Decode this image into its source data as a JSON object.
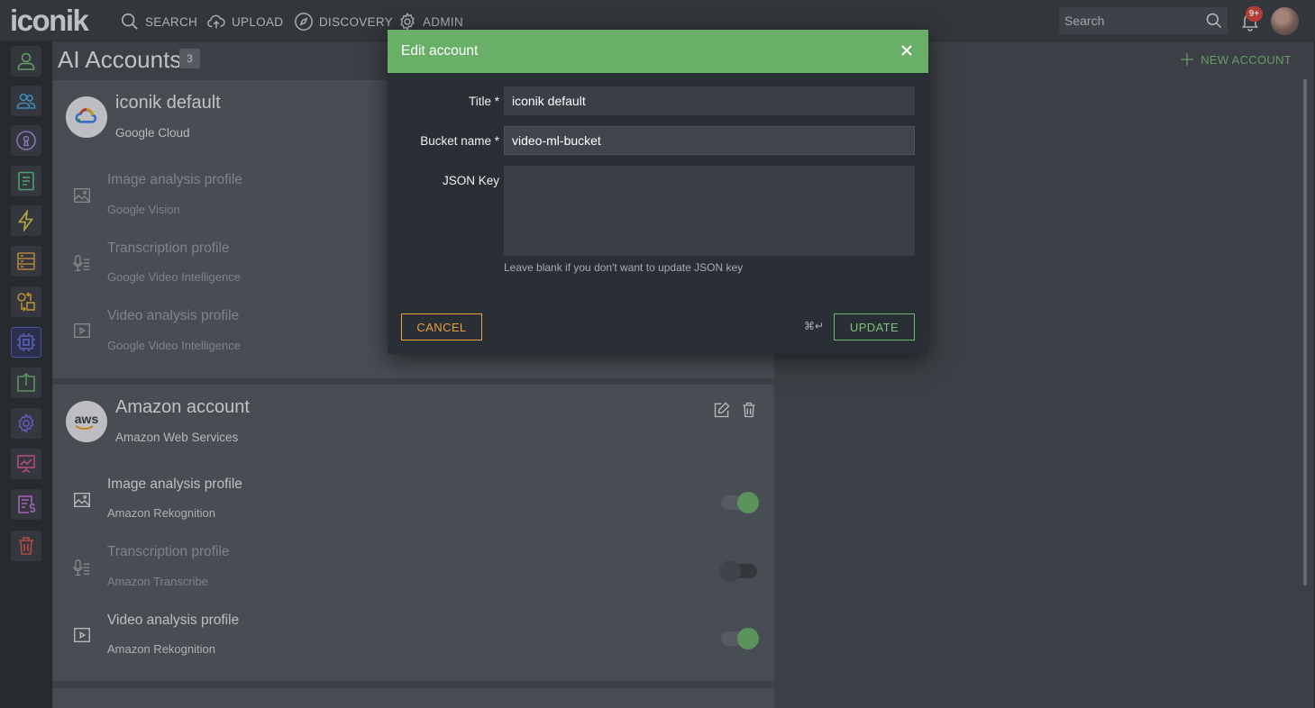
{
  "app": {
    "logo_text": "iconik"
  },
  "topnav": {
    "items": [
      {
        "label": "SEARCH",
        "icon": "search-icon"
      },
      {
        "label": "UPLOAD",
        "icon": "cloud-upload-icon"
      },
      {
        "label": "DISCOVERY",
        "icon": "compass-icon"
      },
      {
        "label": "ADMIN",
        "icon": "gear-icon"
      }
    ],
    "search_placeholder": "Search",
    "notification_count": "9+"
  },
  "sidebar": {
    "items": [
      {
        "icon": "user-icon",
        "color": "#7cc27a"
      },
      {
        "icon": "users-icon",
        "color": "#4fa9e0"
      },
      {
        "icon": "keyhole-icon",
        "color": "#a88be0"
      },
      {
        "icon": "document-icon",
        "color": "#5cc487"
      },
      {
        "icon": "lightning-icon",
        "color": "#e6d84a"
      },
      {
        "icon": "storage-icon",
        "color": "#e0a04a"
      },
      {
        "icon": "transfer-icon",
        "color": "#e6b03c"
      },
      {
        "icon": "cpu-chip-icon",
        "color": "#6b79e6",
        "active": true
      },
      {
        "icon": "export-icon",
        "color": "#6fb76e"
      },
      {
        "icon": "settings-icon",
        "color": "#7a6be6"
      },
      {
        "icon": "presentation-chart-icon",
        "color": "#e05a9c"
      },
      {
        "icon": "invoice-icon",
        "color": "#c67ae0"
      },
      {
        "icon": "trash-icon",
        "color": "#e05a4a"
      }
    ]
  },
  "page": {
    "title": "AI Accounts",
    "count": "3",
    "new_account_label": "NEW ACCOUNT"
  },
  "accounts": [
    {
      "title": "iconik default",
      "provider": "Google Cloud",
      "profiles": [
        {
          "name": "Image analysis profile",
          "provider": "Google Vision"
        },
        {
          "name": "Transcription profile",
          "provider": "Google Video Intelligence"
        },
        {
          "name": "Video analysis profile",
          "provider": "Google Video Intelligence"
        }
      ]
    },
    {
      "title": "Amazon account",
      "provider": "Amazon Web Services",
      "logo_text": "aws",
      "profiles": [
        {
          "name": "Image analysis profile",
          "provider": "Amazon Rekognition",
          "enabled": true
        },
        {
          "name": "Transcription profile",
          "provider": "Amazon Transcribe",
          "enabled": false
        },
        {
          "name": "Video analysis profile",
          "provider": "Amazon Rekognition",
          "enabled": true
        }
      ]
    }
  ],
  "modal": {
    "title": "Edit account",
    "fields": {
      "title_label": "Title *",
      "title_value": "iconik default",
      "bucket_label": "Bucket name *",
      "bucket_value": "video-ml-bucket",
      "json_label": "JSON Key",
      "json_hint": "Leave blank if you don't want to update JSON key"
    },
    "cancel_label": "CANCEL",
    "shortcut_hint": "⌘↵",
    "update_label": "UPDATE",
    "header_color": "#6aaf68"
  }
}
